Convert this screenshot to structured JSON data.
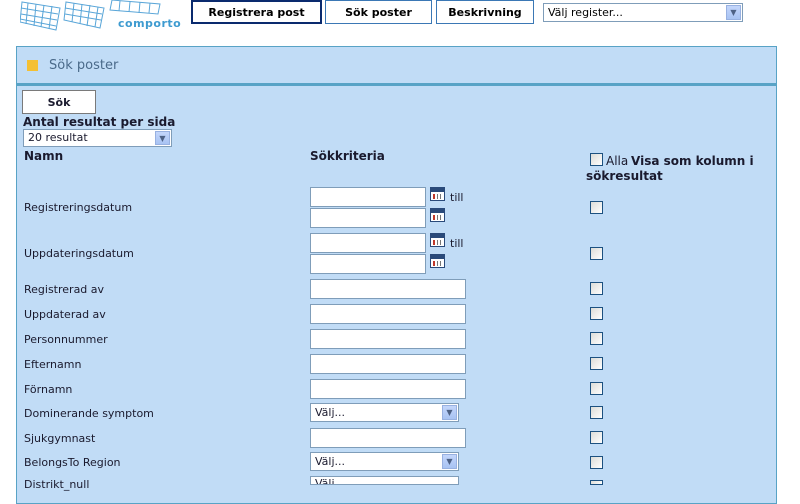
{
  "header": {
    "logo_text": "comporto",
    "buttons": [
      {
        "label": "Registrera post",
        "active": true
      },
      {
        "label": "Sök poster",
        "active": false
      },
      {
        "label": "Beskrivning",
        "active": false
      }
    ],
    "register_select": "Välj register..."
  },
  "panel": {
    "title": "Sök poster",
    "search_button": "Sök",
    "per_page_label": "Antal resultat per sida",
    "per_page_value": "20 resultat",
    "col_name": "Namn",
    "col_criteria": "Sökkriteria",
    "all_label": "Alla",
    "show_as_column_line1": "Visa som kolumn i",
    "show_as_column_line2": "sökresultat",
    "till": "till"
  },
  "rows": [
    {
      "label": "Registreringsdatum",
      "type": "daterange"
    },
    {
      "label": "Uppdateringsdatum",
      "type": "daterange"
    },
    {
      "label": "Registrerad av",
      "type": "text"
    },
    {
      "label": "Uppdaterad av",
      "type": "text"
    },
    {
      "label": "Personnummer",
      "type": "text"
    },
    {
      "label": "Efternamn",
      "type": "text"
    },
    {
      "label": "Förnamn",
      "type": "text"
    },
    {
      "label": "Dominerande symptom",
      "type": "select",
      "value": "Välj..."
    },
    {
      "label": "Sjukgymnast",
      "type": "text"
    },
    {
      "label": "BelongsTo Region",
      "type": "select",
      "value": "Välj..."
    },
    {
      "label": "Distrikt_null",
      "type": "select",
      "value": "Välj..."
    }
  ],
  "colors": {
    "panel_bg": "#c1dcf6",
    "panel_border": "#58a3c6",
    "title_square": "#f4c033"
  }
}
